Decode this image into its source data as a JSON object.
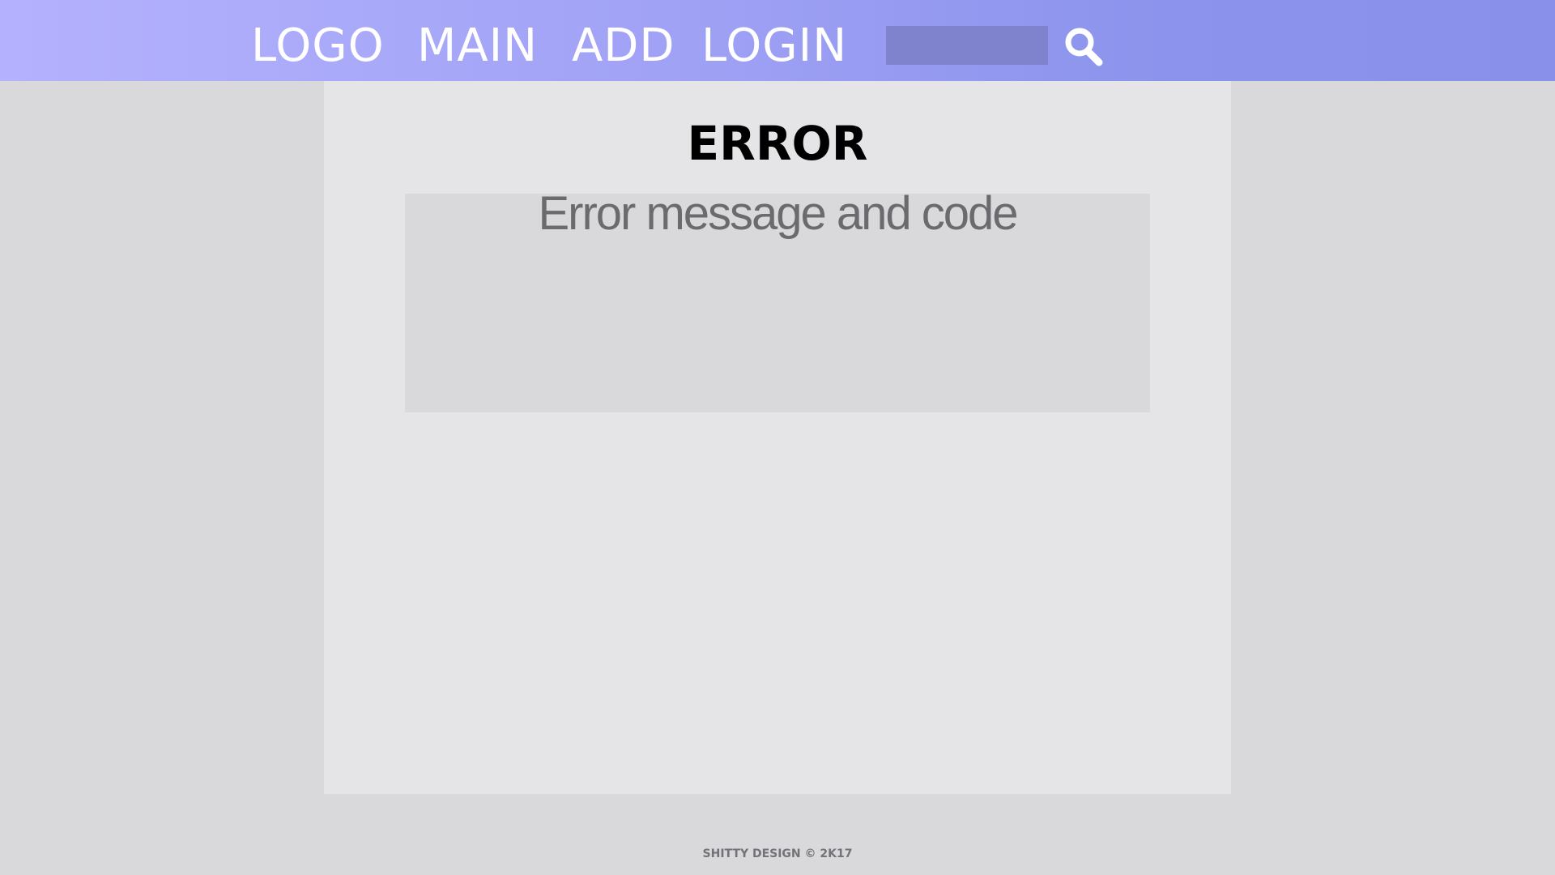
{
  "header": {
    "logo_label": "LOGO",
    "nav": {
      "main_label": "MAIN",
      "add_label": "ADD",
      "login_label": "LOGIN"
    },
    "search": {
      "value": "",
      "placeholder": "",
      "icon": "search-icon"
    }
  },
  "main": {
    "title": "ERROR",
    "error_message": "Error message and code"
  },
  "footer": {
    "text": "SHITTY DESIGN © 2K17"
  },
  "colors": {
    "header_gradient_start": "#b4b2fe",
    "header_gradient_end": "#8890ea",
    "search_box": "#7f82cd",
    "page_background": "#d9d8db",
    "content_background": "#e5e4e7",
    "error_box": "#d9d8db",
    "error_text": "#6b6a6e",
    "footer_text": "#737278"
  }
}
